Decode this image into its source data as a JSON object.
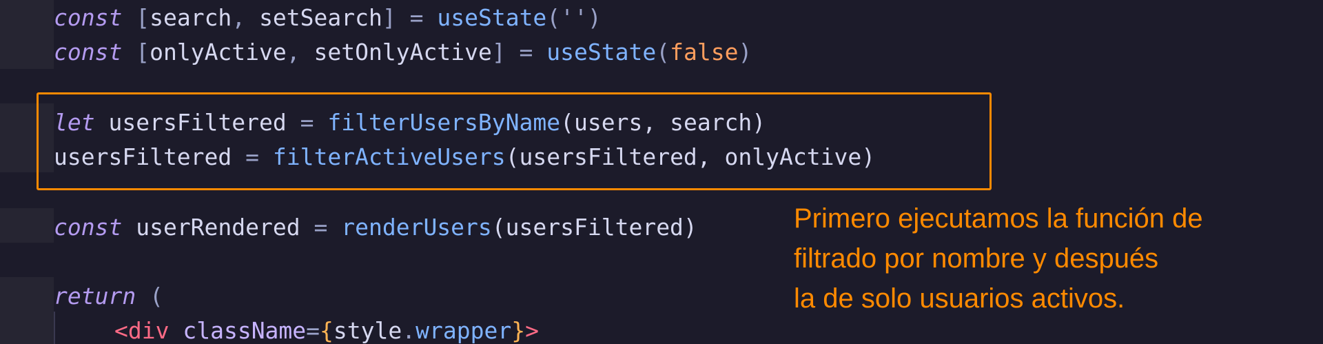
{
  "code": {
    "line1": {
      "kw": "const",
      "bracket_open": " [",
      "var1": "search",
      "comma": ", ",
      "var2": "setSearch",
      "rest": "] = ",
      "fn": "useState",
      "args": "('')"
    },
    "line2": {
      "kw": "const",
      "bracket_open": " [",
      "var1": "onlyActive",
      "comma": ", ",
      "var2": "setOnlyActive",
      "rest": "] = ",
      "fn": "useState",
      "paren_open": "(",
      "lit": "false",
      "paren_close": ")"
    },
    "line3": {
      "kw": "let",
      "var": " usersFiltered",
      "eq": " = ",
      "fn": "filterUsersByName",
      "args": "(users, search)"
    },
    "line4": {
      "var": "usersFiltered",
      "eq": " = ",
      "fn": "filterActiveUsers",
      "args": "(usersFiltered, onlyActive)"
    },
    "line5": {
      "kw": "const",
      "var": " userRendered",
      "eq": " = ",
      "fn": "renderUsers",
      "args": "(usersFiltered)"
    },
    "line6": {
      "kw": "return",
      "rest": " ("
    },
    "line7": {
      "lt": "<",
      "tag": "div",
      "attr": " className",
      "eq": "=",
      "brace_open": "{",
      "obj": "style",
      "dot": ".",
      "prop": "wrapper",
      "brace_close": "}",
      "gt": ">"
    }
  },
  "annotation": {
    "line1": "Primero ejecutamos la función de",
    "line2": "filtrado por nombre y después",
    "line3": "la de solo usuarios activos."
  },
  "colors": {
    "background": "#1c1b2a",
    "highlight": "#ff8a00",
    "keyword": "#b49bf0",
    "function": "#7fb3ff",
    "literal": "#ff9e5e"
  }
}
